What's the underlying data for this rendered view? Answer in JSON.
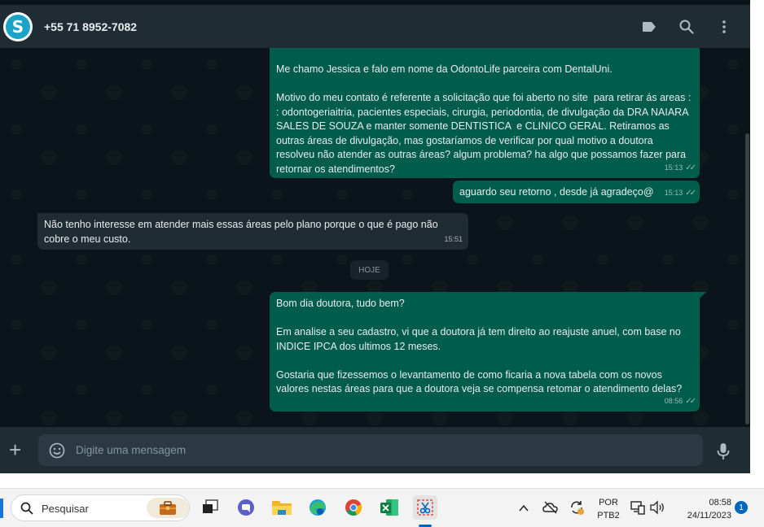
{
  "header": {
    "contact_name": "+55 71 8952-7082",
    "avatar_letter": "S",
    "icons": [
      "label-icon",
      "search-icon",
      "menu-icon"
    ]
  },
  "messages": [
    {
      "direction": "outgoing",
      "text": "Me chamo Jessica e falo em nome da OdontoLife parceira com DentalUni.\n\nMotivo do meu contato é referente a solicitação que foi aberto no site  para retirar ás areas : : odontogeriaitria, pacientes especiais, cirurgia, periodontia, de divulgação da DRA NAIARA SALES DE SOUZA e manter somente DENTISTICA  e CLINICO GERAL. Retiramos as outras áreas de divulgação, mas gostaríamos de verificar por qual motivo a doutora resolveu não atender as outras áreas? algum problema? ha algo que possamos fazer para retornar os atendimentos?",
      "time": "15:13",
      "status": "read"
    },
    {
      "direction": "outgoing",
      "text": "aguardo seu retorno , desde já agradeço@",
      "time": "15:13",
      "status": "read"
    },
    {
      "direction": "incoming",
      "text": "Não tenho interesse em atender mais essas áreas pelo plano porque o que é pago não cobre o meu custo.",
      "time": "15:51"
    },
    {
      "direction": "outgoing",
      "text": "Bom dia doutora, tudo bem?\n\nEm analise a seu cadastro, vi que a doutora já tem direito ao reajuste anuel, com base no INDICE IPCA dos ultimos 12 meses.\n\nGostaria que fizessemos o levantamento de como ficaria a nova tabela com os novos valores nestas áreas para que a doutora veja se compensa retomar o atendimento delas?",
      "time": "08:56",
      "status": "read"
    }
  ],
  "day_divider": "HOJE",
  "composer": {
    "placeholder": "Digite uma mensagem"
  },
  "taskbar": {
    "search_placeholder": "Pesquisar",
    "apps": [
      "briefcase-icon",
      "task-view-icon",
      "teams-chat-icon",
      "file-explorer-icon",
      "edge-icon",
      "chrome-icon",
      "excel-icon",
      "snipping-tool-icon"
    ],
    "language_line1": "POR",
    "language_line2": "PTB2",
    "time": "08:58",
    "date": "24/11/2023",
    "notification_count": "1"
  },
  "colors": {
    "outgoing_bubble": "#005c4b",
    "incoming_bubble": "#202c33",
    "app_background": "#0b141a",
    "header": "#202c33"
  }
}
